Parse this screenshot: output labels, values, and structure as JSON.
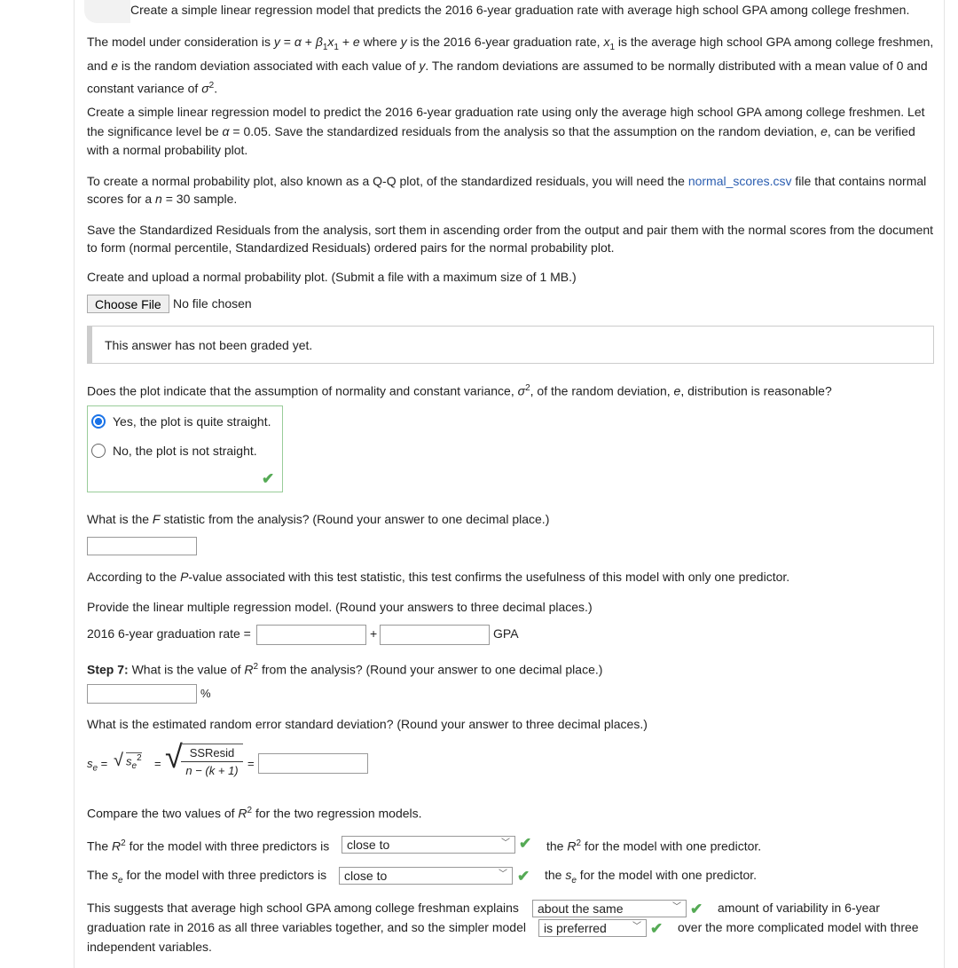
{
  "header": "Create a simple linear regression model that predicts the 2016 6-year graduation rate with average high school GPA among college freshmen.",
  "p1": {
    "a": "The model under consideration is ",
    "b": " where ",
    "c": " is the 2016 6-year graduation rate, ",
    "d": " is the average high school GPA among college freshmen, and ",
    "e": " is the random deviation associated with each value of ",
    "f": ". The random deviations are assumed to be normally distributed with a mean value of 0 and constant variance of "
  },
  "p2": {
    "a": "Create a simple linear regression model to predict the 2016 6-year graduation rate using only the average high school GPA among college freshmen. Let the significance level be ",
    "b": " = 0.05. Save the standardized residuals from the analysis so that the assumption on the random deviation, ",
    "c": ", can be verified with a normal probability plot."
  },
  "p3": {
    "a": "To create a normal probability plot, also known as a Q-Q plot, of the standardized residuals, you will need the ",
    "link": "normal_scores.csv",
    "b": " file that contains normal scores for a ",
    "c": " = 30 sample."
  },
  "p4": "Save the Standardized Residuals from the analysis, sort them in ascending order from the output and pair them with the normal scores from the document to form (normal percentile, Standardized Residuals) ordered pairs for the normal probability plot.",
  "p5": "Create and upload a normal probability plot. (Submit a file with a maximum size of 1 MB.)",
  "file": {
    "button": "Choose File",
    "status": "No file chosen"
  },
  "graded": "This answer has not been graded yet.",
  "q_normal": {
    "a": "Does the plot indicate that the assumption of normality and constant variance, ",
    "b": ", of the random deviation, ",
    "c": ", distribution is reasonable?",
    "options": [
      {
        "label": "Yes, the plot is quite straight.",
        "selected": true
      },
      {
        "label": "No, the plot is not straight.",
        "selected": false
      }
    ]
  },
  "q_f": {
    "a": "What is the ",
    "b": " statistic from the analysis? (Round your answer to one decimal place.)",
    "value": ""
  },
  "p_pvalue": {
    "a": "According to the ",
    "b": "-value associated with this test statistic, this test confirms the usefulness of this model with only one predictor."
  },
  "q_model": {
    "text": "Provide the linear multiple regression model. (Round your answers to three decimal places.)",
    "lhs": "2016 6-year graduation rate =",
    "plus": "+",
    "gpa": "GPA",
    "intercept": "",
    "slope": ""
  },
  "q_r2": {
    "step": "Step 7:",
    "a": " What is the value of ",
    "b": " from the analysis? (Round your answer to one decimal place.)",
    "unit": "%",
    "value": ""
  },
  "q_se": {
    "text": "What is the estimated random error standard deviation? (Round your answer to three decimal places.)",
    "numer": "SSResid",
    "denom": "n − (k + 1)",
    "value": ""
  },
  "compare": {
    "title_a": "Compare the two values of ",
    "title_b": " for the two regression models.",
    "r2_a": "The ",
    "r2_b": " for the model with three predictors is",
    "r2_sel": "close to",
    "r2_c": "the ",
    "r2_d": " for the model with one predictor.",
    "se_a": "The ",
    "se_b": " for the model with three predictors is",
    "se_sel": "close to",
    "se_c": "the ",
    "se_d": " for the model with one predictor.",
    "s_a": "This suggests that average high school GPA among college freshman explains",
    "s_sel1": "about the same",
    "s_b": "amount of variability in 6-year",
    "s_c": "graduation rate in 2016 as all three variables together, and so the simpler model",
    "s_sel2": "is preferred",
    "s_d": "over the more complicated model with three",
    "s_e": "independent variables."
  },
  "colors": {
    "check": "#55aa55",
    "link": "#2a5db0",
    "radio": "#1a73e8",
    "correct_border": "#99cc99"
  }
}
